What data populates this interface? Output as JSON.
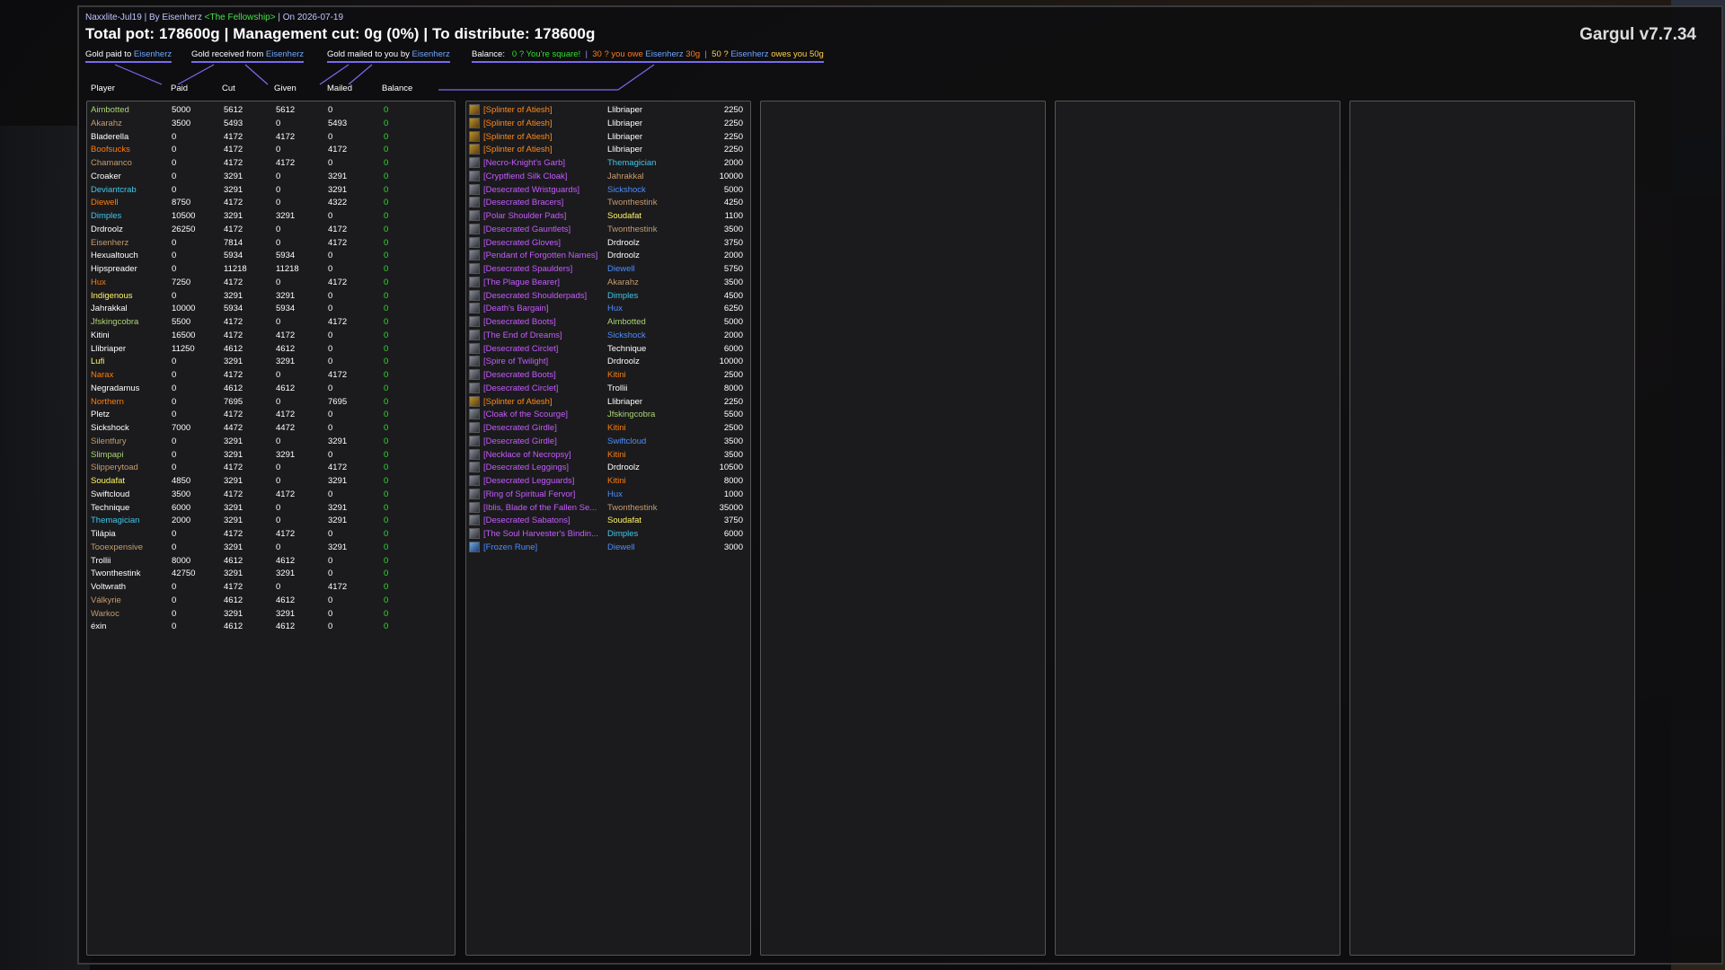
{
  "app": {
    "version": "Gargul v7.7.34"
  },
  "header": {
    "session": "Naxxlite-Jul19 | By Eisenherz ",
    "guild": "<The Fellowship>",
    "date": " | On 2026-07-19",
    "title": "Total pot: 178600g | Management cut: 0g (0%) | To distribute: 178600g"
  },
  "legend": {
    "paid_label": "Gold paid to ",
    "paid_name": "Eisenherz",
    "received_label": "Gold received from ",
    "received_name": "Eisenherz",
    "mailed_label": "Gold mailed to you by ",
    "mailed_name": "Eisenherz",
    "balance_label": "Balance:",
    "square": "0 ? You're square!",
    "owe_prefix": "30 ? you owe ",
    "owe_name": "Eisenherz",
    "owe_amount": " 30g",
    "owes_prefix": "50 ? ",
    "owes_name": "Eisenherz",
    "owes_text": " owes you 50g"
  },
  "columns": {
    "player": "Player",
    "paid": "Paid",
    "cut": "Cut",
    "given": "Given",
    "mailed": "Mailed",
    "balance": "Balance"
  },
  "colors": {
    "accent": "#7a6af0",
    "positive": "#2ee02e",
    "epic": "#c65bff",
    "legendary": "#ff8a1a",
    "rare": "#4d8dff"
  },
  "players": [
    {
      "name": "Aimbotted",
      "color": "#abd473",
      "paid": "5000",
      "cut": "5612",
      "given": "5612",
      "mailed": "0",
      "balance": "0"
    },
    {
      "name": "Akarahz",
      "color": "#c79c6e",
      "paid": "3500",
      "cut": "5493",
      "given": "0",
      "mailed": "5493",
      "balance": "0"
    },
    {
      "name": "Bladerella",
      "color": "#ffffff",
      "paid": "0",
      "cut": "4172",
      "given": "4172",
      "mailed": "0",
      "balance": "0"
    },
    {
      "name": "Boofsucks",
      "color": "#ff7d0a",
      "paid": "0",
      "cut": "4172",
      "given": "0",
      "mailed": "4172",
      "balance": "0"
    },
    {
      "name": "Chamanco",
      "color": "#c79c6e",
      "paid": "0",
      "cut": "4172",
      "given": "4172",
      "mailed": "0",
      "balance": "0"
    },
    {
      "name": "Croaker",
      "color": "#ffffff",
      "paid": "0",
      "cut": "3291",
      "given": "0",
      "mailed": "3291",
      "balance": "0"
    },
    {
      "name": "Deviantcrab",
      "color": "#40c7eb",
      "paid": "0",
      "cut": "3291",
      "given": "0",
      "mailed": "3291",
      "balance": "0"
    },
    {
      "name": "Diewell",
      "color": "#ff7d0a",
      "paid": "8750",
      "cut": "4172",
      "given": "0",
      "mailed": "4322",
      "balance": "0"
    },
    {
      "name": "Dimples",
      "color": "#40c7eb",
      "paid": "10500",
      "cut": "3291",
      "given": "3291",
      "mailed": "0",
      "balance": "0"
    },
    {
      "name": "Drdroolz",
      "color": "#ffffff",
      "paid": "26250",
      "cut": "4172",
      "given": "0",
      "mailed": "4172",
      "balance": "0"
    },
    {
      "name": "Eisenherz",
      "color": "#c79c6e",
      "paid": "0",
      "cut": "7814",
      "given": "0",
      "mailed": "4172",
      "balance": "0"
    },
    {
      "name": "Hexualtouch",
      "color": "#ffffff",
      "paid": "0",
      "cut": "5934",
      "given": "5934",
      "mailed": "0",
      "balance": "0"
    },
    {
      "name": "Hipspreader",
      "color": "#ffffff",
      "paid": "0",
      "cut": "11218",
      "given": "11218",
      "mailed": "0",
      "balance": "0"
    },
    {
      "name": "Hux",
      "color": "#ff7d0a",
      "paid": "7250",
      "cut": "4172",
      "given": "0",
      "mailed": "4172",
      "balance": "0"
    },
    {
      "name": "Indigenous",
      "color": "#fff569",
      "paid": "0",
      "cut": "3291",
      "given": "3291",
      "mailed": "0",
      "balance": "0"
    },
    {
      "name": "Jahrakkal",
      "color": "#ffffff",
      "paid": "10000",
      "cut": "5934",
      "given": "5934",
      "mailed": "0",
      "balance": "0"
    },
    {
      "name": "Jfskingcobra",
      "color": "#abd473",
      "paid": "5500",
      "cut": "4172",
      "given": "0",
      "mailed": "4172",
      "balance": "0"
    },
    {
      "name": "Kitini",
      "color": "#ffffff",
      "paid": "16500",
      "cut": "4172",
      "given": "4172",
      "mailed": "0",
      "balance": "0"
    },
    {
      "name": "Llibriaper",
      "color": "#ffffff",
      "paid": "11250",
      "cut": "4612",
      "given": "4612",
      "mailed": "0",
      "balance": "0"
    },
    {
      "name": "Lufi",
      "color": "#fff569",
      "paid": "0",
      "cut": "3291",
      "given": "3291",
      "mailed": "0",
      "balance": "0"
    },
    {
      "name": "Narax",
      "color": "#ff7d0a",
      "paid": "0",
      "cut": "4172",
      "given": "0",
      "mailed": "4172",
      "balance": "0"
    },
    {
      "name": "Negradamus",
      "color": "#ffffff",
      "paid": "0",
      "cut": "4612",
      "given": "4612",
      "mailed": "0",
      "balance": "0"
    },
    {
      "name": "Northern",
      "color": "#ff7d0a",
      "paid": "0",
      "cut": "7695",
      "given": "0",
      "mailed": "7695",
      "balance": "0"
    },
    {
      "name": "Pletz",
      "color": "#ffffff",
      "paid": "0",
      "cut": "4172",
      "given": "4172",
      "mailed": "0",
      "balance": "0"
    },
    {
      "name": "Sickshock",
      "color": "#ffffff",
      "paid": "7000",
      "cut": "4472",
      "given": "4472",
      "mailed": "0",
      "balance": "0"
    },
    {
      "name": "Silentfury",
      "color": "#c79c6e",
      "paid": "0",
      "cut": "3291",
      "given": "0",
      "mailed": "3291",
      "balance": "0"
    },
    {
      "name": "Slimpapi",
      "color": "#abd473",
      "paid": "0",
      "cut": "3291",
      "given": "3291",
      "mailed": "0",
      "balance": "0"
    },
    {
      "name": "Slipperytoad",
      "color": "#c79c6e",
      "paid": "0",
      "cut": "4172",
      "given": "0",
      "mailed": "4172",
      "balance": "0"
    },
    {
      "name": "Soudafat",
      "color": "#fff569",
      "paid": "4850",
      "cut": "3291",
      "given": "0",
      "mailed": "3291",
      "balance": "0"
    },
    {
      "name": "Swiftcloud",
      "color": "#ffffff",
      "paid": "3500",
      "cut": "4172",
      "given": "4172",
      "mailed": "0",
      "balance": "0"
    },
    {
      "name": "Technique",
      "color": "#ffffff",
      "paid": "6000",
      "cut": "3291",
      "given": "0",
      "mailed": "3291",
      "balance": "0"
    },
    {
      "name": "Themagician",
      "color": "#40c7eb",
      "paid": "2000",
      "cut": "3291",
      "given": "0",
      "mailed": "3291",
      "balance": "0"
    },
    {
      "name": "Tilápia",
      "color": "#ffffff",
      "paid": "0",
      "cut": "4172",
      "given": "4172",
      "mailed": "0",
      "balance": "0"
    },
    {
      "name": "Tooexpensive",
      "color": "#c79c6e",
      "paid": "0",
      "cut": "3291",
      "given": "0",
      "mailed": "3291",
      "balance": "0"
    },
    {
      "name": "Trollii",
      "color": "#ffffff",
      "paid": "8000",
      "cut": "4612",
      "given": "4612",
      "mailed": "0",
      "balance": "0"
    },
    {
      "name": "Twonthestink",
      "color": "#ffffff",
      "paid": "42750",
      "cut": "3291",
      "given": "3291",
      "mailed": "0",
      "balance": "0"
    },
    {
      "name": "Voltwrath",
      "color": "#ffffff",
      "paid": "0",
      "cut": "4172",
      "given": "0",
      "mailed": "4172",
      "balance": "0"
    },
    {
      "name": "Válkyrie",
      "color": "#c79c6e",
      "paid": "0",
      "cut": "4612",
      "given": "4612",
      "mailed": "0",
      "balance": "0"
    },
    {
      "name": "Warkoc",
      "color": "#c79c6e",
      "paid": "0",
      "cut": "3291",
      "given": "3291",
      "mailed": "0",
      "balance": "0"
    },
    {
      "name": "éxin",
      "color": "#ffffff",
      "paid": "0",
      "cut": "4612",
      "given": "4612",
      "mailed": "0",
      "balance": "0"
    }
  ],
  "loot": [
    {
      "item": "[Splinter of Atiesh]",
      "q": "leg",
      "winner": "Llibriaper",
      "wcolor": "#ffffff",
      "price": "2250"
    },
    {
      "item": "[Splinter of Atiesh]",
      "q": "leg",
      "winner": "Llibriaper",
      "wcolor": "#ffffff",
      "price": "2250"
    },
    {
      "item": "[Splinter of Atiesh]",
      "q": "leg",
      "winner": "Llibriaper",
      "wcolor": "#ffffff",
      "price": "2250"
    },
    {
      "item": "[Splinter of Atiesh]",
      "q": "leg",
      "winner": "Llibriaper",
      "wcolor": "#ffffff",
      "price": "2250"
    },
    {
      "item": "[Necro-Knight's Garb]",
      "q": "epic",
      "winner": "Themagician",
      "wcolor": "#40c7eb",
      "price": "2000"
    },
    {
      "item": "[Cryptfiend Silk Cloak]",
      "q": "epic",
      "winner": "Jahrakkal",
      "wcolor": "#c79c6e",
      "price": "10000"
    },
    {
      "item": "[Desecrated Wristguards]",
      "q": "epic",
      "winner": "Sickshock",
      "wcolor": "#4d8dff",
      "price": "5000"
    },
    {
      "item": "[Desecrated Bracers]",
      "q": "epic",
      "winner": "Twonthestink",
      "wcolor": "#c79c6e",
      "price": "4250"
    },
    {
      "item": "[Polar Shoulder Pads]",
      "q": "epic",
      "winner": "Soudafat",
      "wcolor": "#fff569",
      "price": "1100"
    },
    {
      "item": "[Desecrated Gauntlets]",
      "q": "epic",
      "winner": "Twonthestink",
      "wcolor": "#c79c6e",
      "price": "3500"
    },
    {
      "item": "[Desecrated Gloves]",
      "q": "epic",
      "winner": "Drdroolz",
      "wcolor": "#ffffff",
      "price": "3750"
    },
    {
      "item": "[Pendant of Forgotten Names]",
      "q": "epic",
      "winner": "Drdroolz",
      "wcolor": "#ffffff",
      "price": "2000"
    },
    {
      "item": "[Desecrated Spaulders]",
      "q": "epic",
      "winner": "Diewell",
      "wcolor": "#4d8dff",
      "price": "5750"
    },
    {
      "item": "[The Plague Bearer]",
      "q": "epic",
      "winner": "Akarahz",
      "wcolor": "#c79c6e",
      "price": "3500"
    },
    {
      "item": "[Desecrated Shoulderpads]",
      "q": "epic",
      "winner": "Dimples",
      "wcolor": "#40c7eb",
      "price": "4500"
    },
    {
      "item": "[Death's Bargain]",
      "q": "epic",
      "winner": "Hux",
      "wcolor": "#4d8dff",
      "price": "6250"
    },
    {
      "item": "[Desecrated Boots]",
      "q": "epic",
      "winner": "Aimbotted",
      "wcolor": "#abd473",
      "price": "5000"
    },
    {
      "item": "[The End of Dreams]",
      "q": "epic",
      "winner": "Sickshock",
      "wcolor": "#4d8dff",
      "price": "2000"
    },
    {
      "item": "[Desecrated Circlet]",
      "q": "epic",
      "winner": "Technique",
      "wcolor": "#ffffff",
      "price": "6000"
    },
    {
      "item": "[Spire of Twilight]",
      "q": "epic",
      "winner": "Drdroolz",
      "wcolor": "#ffffff",
      "price": "10000"
    },
    {
      "item": "[Desecrated Boots]",
      "q": "epic",
      "winner": "Kitini",
      "wcolor": "#ff7d0a",
      "price": "2500"
    },
    {
      "item": "[Desecrated Circlet]",
      "q": "epic",
      "winner": "Trollii",
      "wcolor": "#ffffff",
      "price": "8000"
    },
    {
      "item": "[Splinter of Atiesh]",
      "q": "leg",
      "winner": "Llibriaper",
      "wcolor": "#ffffff",
      "price": "2250"
    },
    {
      "item": "[Cloak of the Scourge]",
      "q": "epic",
      "winner": "Jfskingcobra",
      "wcolor": "#abd473",
      "price": "5500"
    },
    {
      "item": "[Desecrated Girdle]",
      "q": "epic",
      "winner": "Kitini",
      "wcolor": "#ff7d0a",
      "price": "2500"
    },
    {
      "item": "[Desecrated Girdle]",
      "q": "epic",
      "winner": "Swiftcloud",
      "wcolor": "#4d8dff",
      "price": "3500"
    },
    {
      "item": "[Necklace of Necropsy]",
      "q": "epic",
      "winner": "Kitini",
      "wcolor": "#ff7d0a",
      "price": "3500"
    },
    {
      "item": "[Desecrated Leggings]",
      "q": "epic",
      "winner": "Drdroolz",
      "wcolor": "#ffffff",
      "price": "10500"
    },
    {
      "item": "[Desecrated Legguards]",
      "q": "epic",
      "winner": "Kitini",
      "wcolor": "#ff7d0a",
      "price": "8000"
    },
    {
      "item": "[Ring of Spiritual Fervor]",
      "q": "epic",
      "winner": "Hux",
      "wcolor": "#4d8dff",
      "price": "1000"
    },
    {
      "item": "[Iblis, Blade of the Fallen Se...",
      "q": "epic",
      "winner": "Twonthestink",
      "wcolor": "#c79c6e",
      "price": "35000"
    },
    {
      "item": "[Desecrated Sabatons]",
      "q": "epic",
      "winner": "Soudafat",
      "wcolor": "#fff569",
      "price": "3750"
    },
    {
      "item": "[The Soul Harvester's Bindin...",
      "q": "epic",
      "winner": "Dimples",
      "wcolor": "#40c7eb",
      "price": "6000"
    },
    {
      "item": "[Frozen Rune]",
      "q": "rare",
      "winner": "Diewell",
      "wcolor": "#4d8dff",
      "price": "3000"
    }
  ]
}
